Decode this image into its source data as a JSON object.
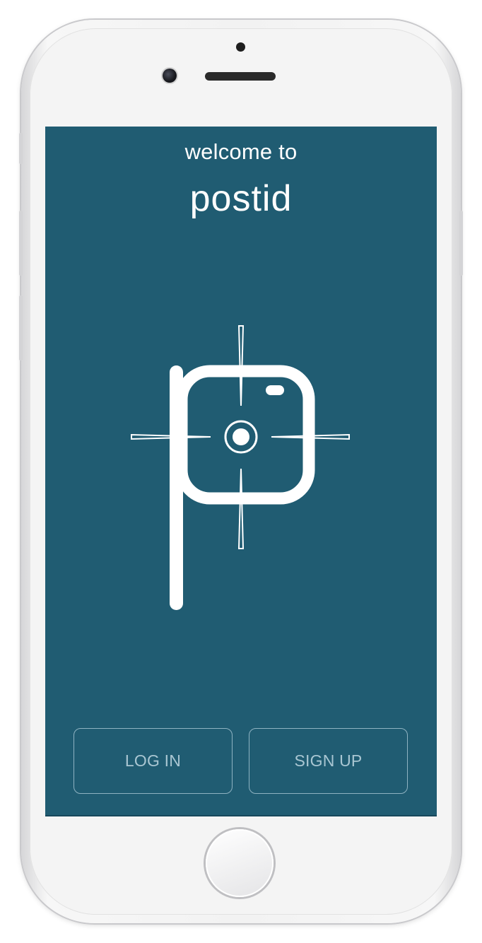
{
  "welcome_text": "welcome to",
  "brand_name": "postid",
  "buttons": {
    "login_label": "LOG IN",
    "signup_label": "SIGN UP"
  },
  "colors": {
    "screen_background": "#205c72",
    "button_border": "#8fb3c2",
    "button_text": "#a9c6d2",
    "logo": "#ffffff"
  },
  "icons": [
    "postid-logo-icon",
    "home-button"
  ]
}
